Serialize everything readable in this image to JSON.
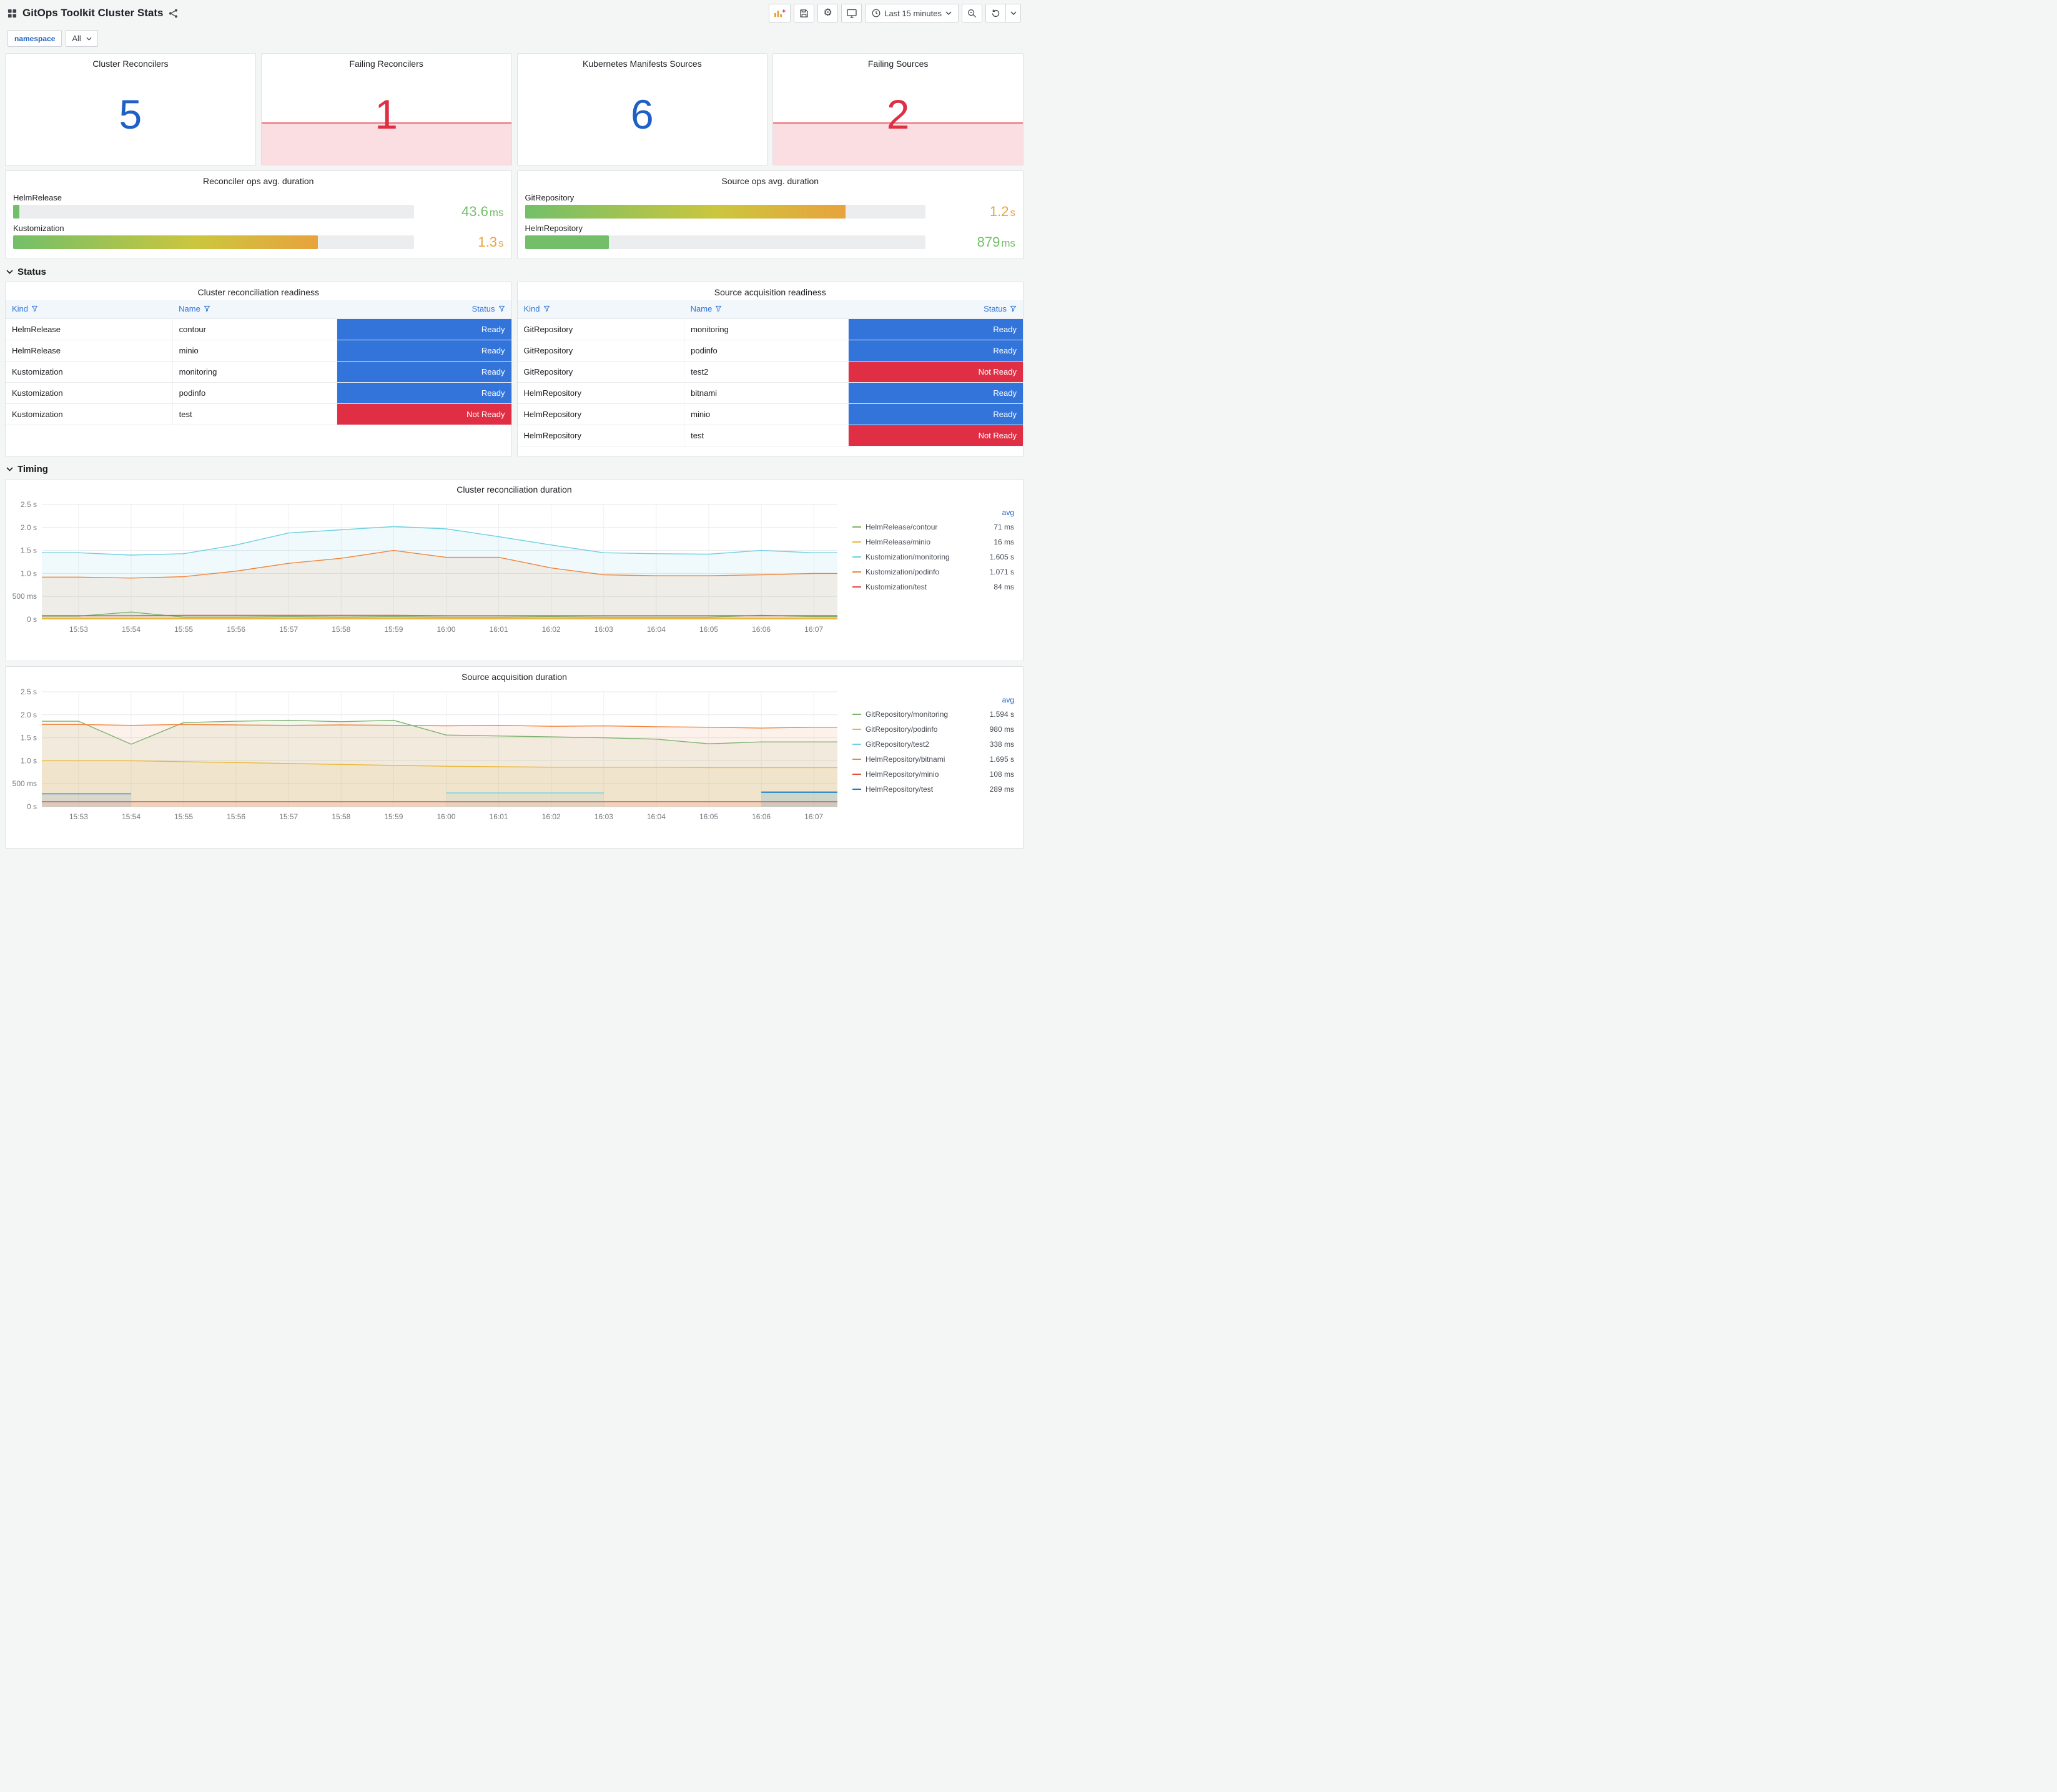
{
  "header": {
    "title": "GitOps Toolkit Cluster Stats",
    "time_range_label": "Last 15 minutes"
  },
  "variables": {
    "namespace_label": "namespace",
    "namespace_value": "All"
  },
  "colors": {
    "stat_blue": "#1F60C4",
    "stat_red": "#DE2F43",
    "ready": "#3274D9",
    "not_ready": "#E02F44",
    "value_green": "#73BF69",
    "value_orange": "#E8A33D"
  },
  "stat_panels": [
    {
      "title": "Cluster Reconcilers",
      "value": "5",
      "color": "#1F60C4",
      "sparkline": false
    },
    {
      "title": "Failing Reconcilers",
      "value": "1",
      "color": "#DE2F43",
      "sparkline": true
    },
    {
      "title": "Kubernetes Manifests Sources",
      "value": "6",
      "color": "#1F60C4",
      "sparkline": false
    },
    {
      "title": "Failing Sources",
      "value": "2",
      "color": "#DE2F43",
      "sparkline": true
    }
  ],
  "gauge_panels": [
    {
      "title": "Reconciler ops avg. duration",
      "bars": [
        {
          "label": "HelmRelease",
          "value": "43.6",
          "unit": "ms",
          "percent": 1.5,
          "mode": "solid",
          "text_color": "#73BF69"
        },
        {
          "label": "Kustomization",
          "value": "1.3",
          "unit": "s",
          "percent": 76,
          "mode": "gradient",
          "text_color": "#E8A33D"
        }
      ]
    },
    {
      "title": "Source ops avg. duration",
      "bars": [
        {
          "label": "GitRepository",
          "value": "1.2",
          "unit": "s",
          "percent": 80,
          "mode": "gradient",
          "text_color": "#E8A33D"
        },
        {
          "label": "HelmRepository",
          "value": "879",
          "unit": "ms",
          "percent": 21,
          "mode": "solid",
          "text_color": "#73BF69"
        }
      ]
    }
  ],
  "sections": {
    "status": "Status",
    "timing": "Timing"
  },
  "status_tables": [
    {
      "title": "Cluster reconciliation readiness",
      "columns": [
        "Kind",
        "Name",
        "Status"
      ],
      "rows": [
        {
          "kind": "HelmRelease",
          "name": "contour",
          "status": "Ready"
        },
        {
          "kind": "HelmRelease",
          "name": "minio",
          "status": "Ready"
        },
        {
          "kind": "Kustomization",
          "name": "monitoring",
          "status": "Ready"
        },
        {
          "kind": "Kustomization",
          "name": "podinfo",
          "status": "Ready"
        },
        {
          "kind": "Kustomization",
          "name": "test",
          "status": "Not Ready"
        }
      ]
    },
    {
      "title": "Source acquisition readiness",
      "columns": [
        "Kind",
        "Name",
        "Status"
      ],
      "rows": [
        {
          "kind": "GitRepository",
          "name": "monitoring",
          "status": "Ready"
        },
        {
          "kind": "GitRepository",
          "name": "podinfo",
          "status": "Ready"
        },
        {
          "kind": "GitRepository",
          "name": "test2",
          "status": "Not Ready"
        },
        {
          "kind": "HelmRepository",
          "name": "bitnami",
          "status": "Ready"
        },
        {
          "kind": "HelmRepository",
          "name": "minio",
          "status": "Ready"
        },
        {
          "kind": "HelmRepository",
          "name": "test",
          "status": "Not Ready"
        }
      ]
    }
  ],
  "chart_data": [
    {
      "type": "line",
      "title": "Cluster reconciliation duration",
      "x": [
        "15:53",
        "15:54",
        "15:55",
        "15:56",
        "15:57",
        "15:58",
        "15:59",
        "16:00",
        "16:01",
        "16:02",
        "16:03",
        "16:04",
        "16:05",
        "16:06",
        "16:07"
      ],
      "ylim": [
        0,
        2.5
      ],
      "yticks": [
        0,
        0.5,
        1.0,
        1.5,
        2.0,
        2.5
      ],
      "ytick_labels": [
        "0 s",
        "500 ms",
        "1.0 s",
        "1.5 s",
        "2.0 s",
        "2.5 s"
      ],
      "grid": true,
      "legend_position": "right",
      "legend_header": "avg",
      "series": [
        {
          "name": "HelmRelease/contour",
          "avg": "71 ms",
          "color": "#7EB26D",
          "values": [
            0.07,
            0.16,
            0.05,
            0.05,
            0.06,
            0.05,
            0.06,
            0.05,
            0.05,
            0.06,
            0.05,
            0.05,
            0.05,
            0.09,
            0.06
          ]
        },
        {
          "name": "HelmRelease/minio",
          "avg": "16 ms",
          "color": "#EAB839",
          "values": [
            0.02,
            0.02,
            0.02,
            0.02,
            0.02,
            0.02,
            0.02,
            0.02,
            0.02,
            0.02,
            0.02,
            0.02,
            0.02,
            0.02,
            0.02
          ]
        },
        {
          "name": "Kustomization/monitoring",
          "avg": "1.605 s",
          "color": "#6ED0E0",
          "values": [
            1.45,
            1.4,
            1.43,
            1.62,
            1.88,
            1.95,
            2.02,
            1.97,
            1.8,
            1.62,
            1.45,
            1.43,
            1.42,
            1.5,
            1.45
          ]
        },
        {
          "name": "Kustomization/podinfo",
          "avg": "1.071 s",
          "color": "#EF843C",
          "values": [
            0.92,
            0.9,
            0.93,
            1.05,
            1.22,
            1.33,
            1.5,
            1.35,
            1.35,
            1.12,
            0.97,
            0.95,
            0.95,
            0.97,
            1.0
          ]
        },
        {
          "name": "Kustomization/test",
          "avg": "84 ms",
          "color": "#E24D42",
          "values": [
            0.08,
            0.08,
            0.09,
            0.09,
            0.09,
            0.09,
            0.09,
            0.08,
            0.08,
            0.08,
            0.08,
            0.08,
            0.08,
            0.08,
            0.08
          ]
        }
      ]
    },
    {
      "type": "line",
      "title": "Source acquisition duration",
      "x": [
        "15:53",
        "15:54",
        "15:55",
        "15:56",
        "15:57",
        "15:58",
        "15:59",
        "16:00",
        "16:01",
        "16:02",
        "16:03",
        "16:04",
        "16:05",
        "16:06",
        "16:07"
      ],
      "ylim": [
        0,
        2.5
      ],
      "yticks": [
        0,
        0.5,
        1.0,
        1.5,
        2.0,
        2.5
      ],
      "ytick_labels": [
        "0 s",
        "500 ms",
        "1.0 s",
        "1.5 s",
        "2.0 s",
        "2.5 s"
      ],
      "grid": true,
      "legend_position": "right",
      "legend_header": "avg",
      "series": [
        {
          "name": "GitRepository/monitoring",
          "avg": "1.594 s",
          "color": "#7EB26D",
          "values": [
            1.86,
            1.36,
            1.83,
            1.86,
            1.88,
            1.85,
            1.88,
            1.56,
            1.54,
            1.52,
            1.5,
            1.47,
            1.37,
            1.41,
            1.41
          ]
        },
        {
          "name": "GitRepository/podinfo",
          "avg": "980 ms",
          "color": "#EAB839",
          "values": [
            1.0,
            1.0,
            0.98,
            0.96,
            0.94,
            0.92,
            0.9,
            0.88,
            0.87,
            0.86,
            0.86,
            0.86,
            0.85,
            0.85,
            0.85
          ]
        },
        {
          "name": "GitRepository/test2",
          "avg": "338 ms",
          "color": "#6ED0E0",
          "values": [
            null,
            null,
            null,
            null,
            null,
            null,
            null,
            0.3,
            0.3,
            0.3,
            0.3,
            null,
            null,
            0.33,
            0.33
          ]
        },
        {
          "name": "HelmRepository/bitnami",
          "avg": "1.695 s",
          "color": "#EF843C",
          "values": [
            1.79,
            1.77,
            1.79,
            1.78,
            1.77,
            1.78,
            1.77,
            1.76,
            1.77,
            1.75,
            1.76,
            1.74,
            1.73,
            1.71,
            1.73
          ]
        },
        {
          "name": "HelmRepository/minio",
          "avg": "108 ms",
          "color": "#E24D42",
          "values": [
            0.11,
            0.11,
            0.11,
            0.11,
            0.11,
            0.11,
            0.11,
            0.11,
            0.11,
            0.11,
            0.11,
            0.11,
            0.11,
            0.11,
            0.11
          ]
        },
        {
          "name": "HelmRepository/test",
          "avg": "289 ms",
          "color": "#1F78C1",
          "values": [
            0.28,
            0.28,
            null,
            null,
            null,
            null,
            null,
            null,
            null,
            null,
            null,
            null,
            null,
            0.31,
            0.31
          ]
        }
      ]
    }
  ]
}
